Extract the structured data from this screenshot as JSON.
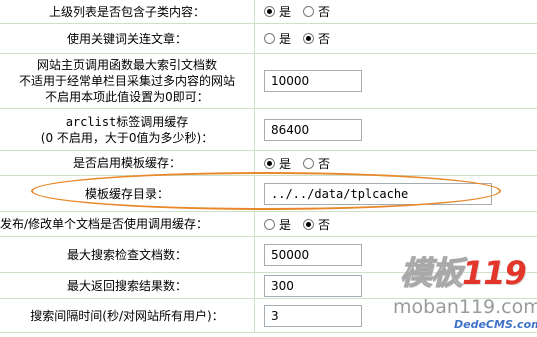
{
  "options": {
    "yes": "是",
    "no": "否"
  },
  "rows": [
    {
      "label": "上级列表是否包含子类内容：",
      "type": "radio",
      "selected": "yes"
    },
    {
      "label": "使用关键词关连文章：",
      "type": "radio",
      "selected": "no"
    },
    {
      "label_lines": [
        "网站主页调用函数最大索引文档数",
        "不适用于经常单栏目采集过多内容的网站",
        "不启用本项此值设置为0即可："
      ],
      "type": "text",
      "value": "10000"
    },
    {
      "label_lines": [
        "arclist标签调用缓存",
        "(0 不启用，大于0值为多少秒)："
      ],
      "type": "text",
      "value": "86400"
    },
    {
      "label": "是否启用模板缓存：",
      "type": "radio",
      "selected": "yes"
    },
    {
      "label": "模板缓存目录：",
      "type": "text",
      "value": "../../data/tplcache"
    },
    {
      "label": "发布/修改单个文档是否使用调用缓存：",
      "type": "radio",
      "selected": "no"
    },
    {
      "label": "最大搜索检查文档数：",
      "type": "text",
      "value": "50000"
    },
    {
      "label": "最大返回搜索结果数：",
      "type": "text",
      "value": "300"
    },
    {
      "label": "搜索间隔时间(秒/对网站所有用户)：",
      "type": "text",
      "value": "3"
    }
  ],
  "watermark": {
    "logo_cn": "模板",
    "logo_num": "119",
    "site": "moban119.com",
    "partner": "DedeCMS.com"
  },
  "highlight_color": "#e8882a"
}
